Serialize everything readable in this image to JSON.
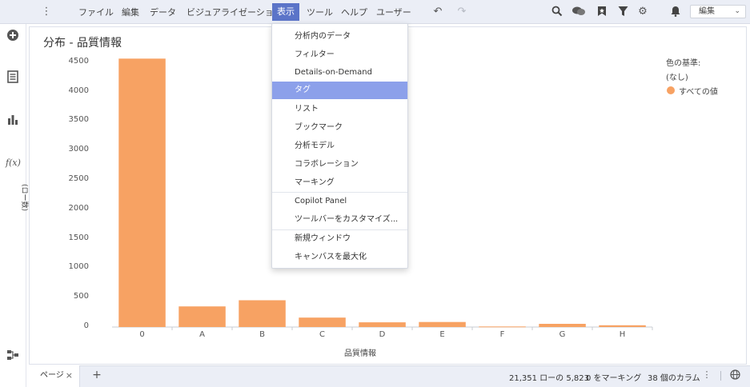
{
  "menubar": {
    "items": [
      "ファイル",
      "編集",
      "データ",
      "ビジュアライゼーション",
      "表示",
      "ツール",
      "ヘルプ",
      "ユーザー"
    ],
    "active_index": 4,
    "mode_select": "編集",
    "icons": [
      "undo-icon",
      "redo-icon",
      "search-icon",
      "comments-icon",
      "bookmark-icon",
      "filter-icon",
      "settings-icon",
      "notification-icon"
    ]
  },
  "sidebar": {
    "icons": [
      "add-icon",
      "data-table-icon",
      "bar-chart-icon",
      "function-icon",
      "data-flow-icon"
    ],
    "fx_label": "f(x)"
  },
  "visualization": {
    "title": "分布 - 品質情報"
  },
  "dropdown": {
    "items": [
      "分析内のデータ",
      "フィルター",
      "Details-on-Demand",
      "タグ",
      "リスト",
      "ブックマーク",
      "分析モデル",
      "コラボレーション",
      "マーキング",
      "Copilot Panel",
      "ツールバーをカスタマイズ...",
      "新規ウィンドウ",
      "キャンバスを最大化"
    ],
    "highlighted_index": 3
  },
  "chart_data": {
    "type": "bar",
    "categories": [
      "0",
      "A",
      "B",
      "C",
      "D",
      "E",
      "F",
      "G",
      "H"
    ],
    "values": [
      4560,
      350,
      455,
      160,
      80,
      85,
      10,
      55,
      30
    ],
    "xlabel": "品質情報",
    "ylabel": "(ロー数)",
    "ylim": [
      0,
      4700
    ],
    "yticks": [
      0,
      500,
      1000,
      1500,
      2000,
      2500,
      3000,
      3500,
      4000,
      4500
    ],
    "bar_color": "#f7a263",
    "legend_title": "色の基準:",
    "legend_sub": "(なし)",
    "legend_entry": "すべての値",
    "legend_placement": "top-right"
  },
  "statusbar": {
    "page_tab": "ページ",
    "rows": "21,351 ローの 5,823",
    "marking": "0 をマーキング",
    "columns": "38 個のカラム"
  },
  "colors": {
    "accent": "#5b74c8",
    "highlight": "#8ca0ea",
    "bar": "#f7a263"
  }
}
